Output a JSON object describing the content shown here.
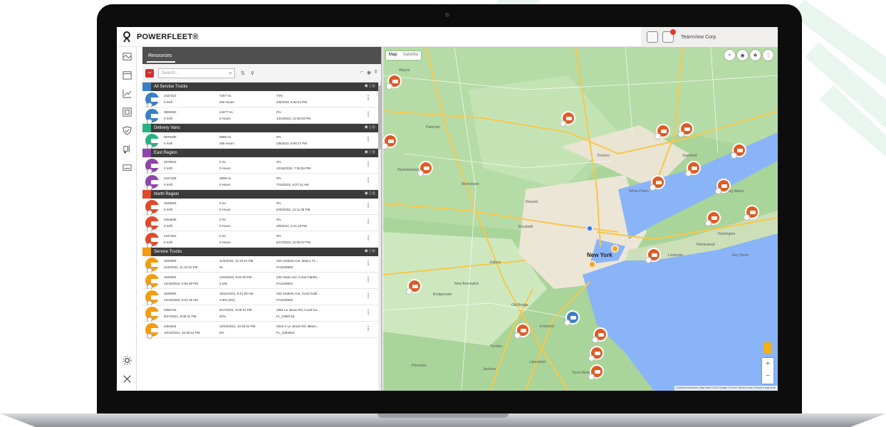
{
  "app": {
    "brand": "POWERFLEET®",
    "company": "TeamView Corp"
  },
  "panel": {
    "title": "Resources",
    "search_placeholder": "Search..."
  },
  "groups": [
    {
      "name": "All Service Trucks",
      "color": "#3a7fc4",
      "rows": [
        {
          "id": "2447323",
          "speed": "0 mi/h",
          "c2a": "7267 mi.",
          "c2b": "409 Hours",
          "c3a": "74%",
          "c3b": "2/8/2023, 8:46:44 PM"
        },
        {
          "id": "0808350",
          "speed": "0 mi/h",
          "c2a": "44477 mi.",
          "c2b": "0 Hours",
          "c3a": "0%",
          "c3b": "1/24/2023, 12:35:03 PM"
        }
      ]
    },
    {
      "name": "Delivery Vans",
      "color": "#2bb07f",
      "rows": [
        {
          "id": "0675309",
          "speed": "0 mi/h",
          "c2a": "5998 mi.",
          "c2b": "256 Hours",
          "c3a": "0%",
          "c3b": "2/8/2023, 8:59:17 PM"
        }
      ]
    },
    {
      "name": "East Region",
      "color": "#8e44ad",
      "rows": [
        {
          "id": "1878603",
          "speed": "0 mi/h",
          "c2a": "0 mi.",
          "c2b": "0 Hours",
          "c3a": "0%",
          "c3b": "10/15/2022, 7:06:52 PM"
        },
        {
          "id": "2447329",
          "speed": "0 mi/h",
          "c2a": "3938 mi.",
          "c2b": "0 Hours",
          "c3a": "0%",
          "c3b": "7/10/2022, 8:07:31 AM"
        }
      ]
    },
    {
      "name": "North Region",
      "color": "#e04a2b",
      "rows": [
        {
          "id": "1840918",
          "speed": "0 mi/h",
          "c2a": "0 mi.",
          "c2b": "0 Hours",
          "c3a": "0%",
          "c3b": "6/30/2022, 11:11:38 PM"
        },
        {
          "id": "2454848",
          "speed": "0 mi/h",
          "c2a": "0 mi.",
          "c2b": "0 Hours",
          "c3a": "0%",
          "c3b": "3/9/2021, 4:41:33 PM"
        },
        {
          "id": "2447322",
          "speed": "0 mi/h",
          "c2a": "0 mi.",
          "c2b": "0 Hours",
          "c3a": "0%",
          "c3b": "6/17/2022, 10:25:07 PM"
        }
      ]
    },
    {
      "name": "Service Trucks",
      "color": "#f39c12",
      "rows": [
        {
          "id": "1840909",
          "speed": "11/6/2022, 11:10:10 PM",
          "c2a": "11/6/2022, 11:10:10 PM",
          "c2b": "0s",
          "c3a": "340 Cedeira Ave, Miami, FL...",
          "c3b": "FA1840909"
        },
        {
          "id": "1840924",
          "speed": "12/15/2022, 5:50:49 PM",
          "c2a": "1/23/2023, 5:01:29 PM",
          "c2b": "4:18s",
          "c3a": "230 Aledo Ave, Coral Gables...",
          "c3b": "FA1840924"
        },
        {
          "id": "1840925",
          "speed": "12/16/2022, 8:21:29 AM",
          "c2a": "10/11/2022, 8:21:29 AM",
          "c2b": "3:30s (0%)",
          "c3a": "333 Cedeira Ave, Coral Gabl...",
          "c3b": "FA1840925"
        },
        {
          "id": "2356718",
          "speed": "8/17/2021, 8:06:31 PM",
          "c2a": "8/17/2021, 8:06:31 PM",
          "c2b": "40%",
          "c3a": "1801 Le Jeune Rd, Coral Ga...",
          "c3b": "FL_2356718"
        },
        {
          "id": "2364634",
          "speed": "10/10/2021, 10:46:24 PM",
          "c2a": "10/10/2021, 10:46:24 PM",
          "c2b": "0%",
          "c3a": "2815 S Le Jeune Rd, Miami...",
          "c3b": "FL_2364634"
        }
      ]
    }
  ],
  "map": {
    "toggle_map": "Map",
    "toggle_satellite": "Satellite",
    "city_label": "New York",
    "places": [
      "Wayne",
      "Paterson",
      "Newark",
      "Elizabeth",
      "Edison",
      "Trenton",
      "New Brunswick",
      "Stamford",
      "White Plains",
      "Long Island",
      "Hempstead",
      "Morristown",
      "Bridgewater",
      "Princeton",
      "Freehold",
      "Toms River",
      "Hackettstown",
      "Yonkers",
      "Old Bridge",
      "Bay Shore",
      "Huntington",
      "Lakewood",
      "Jackson",
      "Levittown"
    ],
    "attribution": "Keyboard shortcuts | Map data ©2023 Google | 10 km | Terms of Use | Report a map error"
  }
}
